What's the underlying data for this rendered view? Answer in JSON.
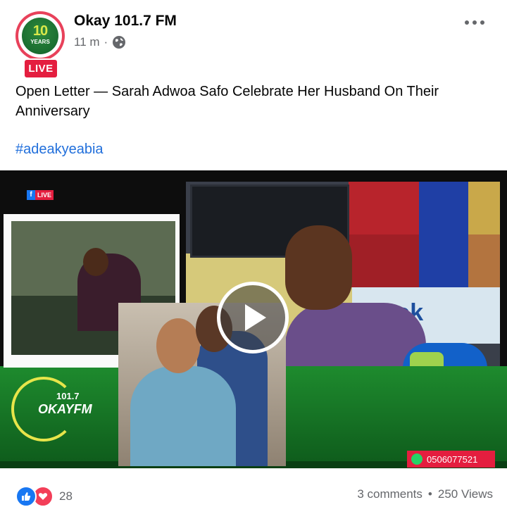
{
  "post": {
    "page_name": "Okay 101.7 FM",
    "time": "11 m",
    "separator": "·",
    "live_badge": "LIVE",
    "avatar_years": "YEARS",
    "avatar_number": "10",
    "text": "Open Letter — Sarah Adwoa Safo Celebrate Her Husband On Their Anniversary",
    "hashtag": "#adeakyeabia"
  },
  "video": {
    "fb_live_label": "LIVE",
    "fb_letter": "f",
    "banner_text": "book",
    "logo_frequency": "101.7",
    "logo_name": "OKAYFM",
    "phone": "0506077521"
  },
  "footer": {
    "reaction_count": "28",
    "comments": "3 comments",
    "dot": "•",
    "views": "250 Views"
  },
  "icons": {
    "globe": "globe-icon",
    "more": "more-icon",
    "play": "play-icon",
    "like": "like-icon",
    "love": "love-icon"
  },
  "colors": {
    "live_red": "#e41e3f",
    "link_blue": "#216fdb",
    "like_blue": "#1877f2",
    "love_red": "#f33e58",
    "meta_gray": "#65676b"
  }
}
